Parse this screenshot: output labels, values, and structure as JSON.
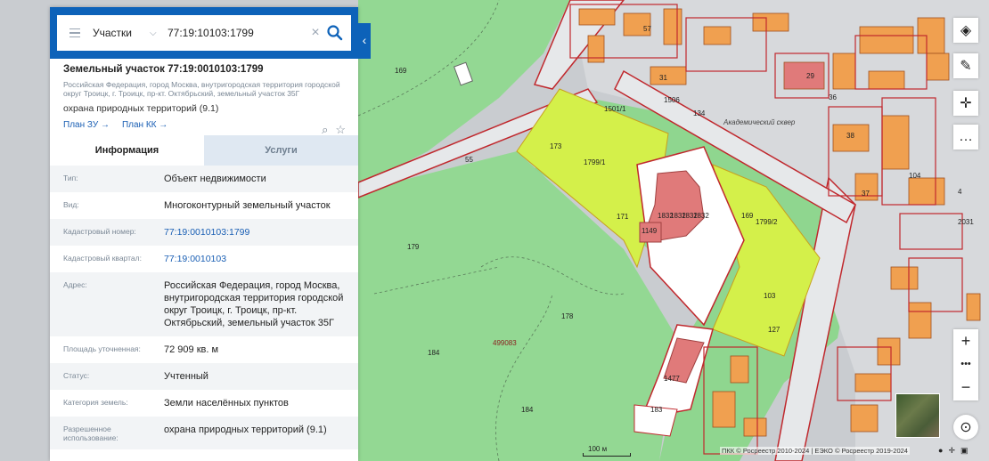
{
  "search": {
    "category": "Участки",
    "query": "77:19:10103:1799"
  },
  "parcel": {
    "title": "Земельный участок 77:19:0010103:1799",
    "address_short": "Российская Федерация, город Москва, внутригородская территория городской округ Троицк, г. Троицк, пр-кт. Октябрьский, земельный участок 35Г",
    "use": "охрана природных территорий (9.1)",
    "links": [
      "План ЗУ →",
      "План КК →"
    ]
  },
  "tabs": [
    "Информация",
    "Услуги"
  ],
  "properties": [
    {
      "label": "Тип:",
      "value": "Объект недвижимости",
      "link": false
    },
    {
      "label": "Вид:",
      "value": "Многоконтурный земельный участок",
      "link": false
    },
    {
      "label": "Кадастровый номер:",
      "value": "77:19:0010103:1799",
      "link": true
    },
    {
      "label": "Кадастровый квартал:",
      "value": "77:19:0010103",
      "link": true
    },
    {
      "label": "Адрес:",
      "value": "Российская Федерация, город Москва, внутригородская территория городской округ Троицк, г. Троицк, пр-кт. Октябрьский, земельный участок 35Г",
      "link": false
    },
    {
      "label": "Площадь уточненная:",
      "value": "72 909 кв. м",
      "link": false
    },
    {
      "label": "Статус:",
      "value": "Учтенный",
      "link": false
    },
    {
      "label": "Категория земель:",
      "value": "Земли населённых пунктов",
      "link": false
    },
    {
      "label": "Разрешенное использование:",
      "value": "охрана природных территорий (9.1)",
      "link": false
    }
  ],
  "map": {
    "labels": {
      "l1799_1": "1799/1",
      "l1799_2": "1799/2",
      "l1832a": "1832",
      "l1832b": "1832",
      "l1832c": "1832",
      "l1832d": "1832",
      "l1149": "1149",
      "l103": "103",
      "l1477": "1477",
      "l183": "183",
      "l499083": "499083",
      "l57": "57",
      "l31": "31",
      "l1506": "1506",
      "l134": "134",
      "l1501": "1501/1",
      "l29": "29",
      "l36": "36",
      "l38": "38",
      "l37": "37",
      "l104": "104",
      "l4": "4",
      "l2031": "2031",
      "l55": "55",
      "l169": "169",
      "l179": "179",
      "l178": "178",
      "l184a": "184",
      "l184b": "184",
      "l173": "173",
      "l171": "171",
      "l127": "127",
      "l169b": "169",
      "street": "Академический сквер"
    },
    "scale_label": "100 м",
    "copyright": "ПКК © Росреестр 2010-2024 | ЕЭКО © Росреестр 2019-2024"
  },
  "colors": {
    "header_blue": "#0d62b9",
    "forest_green": "#8fd68f",
    "parcel_yellow": "#d4f04a",
    "building_orange": "#f0a050",
    "boundary_red": "#c0282d"
  }
}
